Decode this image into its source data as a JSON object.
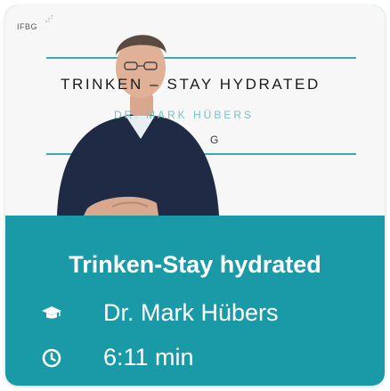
{
  "thumbnail": {
    "logo_text": "IFBG",
    "headline": "TRINKEN – STAY HYDRATED",
    "speaker": "DR. MARK HÜBERS",
    "fragment": "G"
  },
  "card": {
    "title": "Trinken-Stay hydrated",
    "author": "Dr. Mark Hübers",
    "duration": "6:11 min"
  },
  "icons": {
    "author": "graduation-cap-icon",
    "duration": "clock-icon"
  },
  "colors": {
    "accent": "#1a9aa6",
    "line": "#3fa6b2",
    "text_on_accent": "#ffffff"
  }
}
